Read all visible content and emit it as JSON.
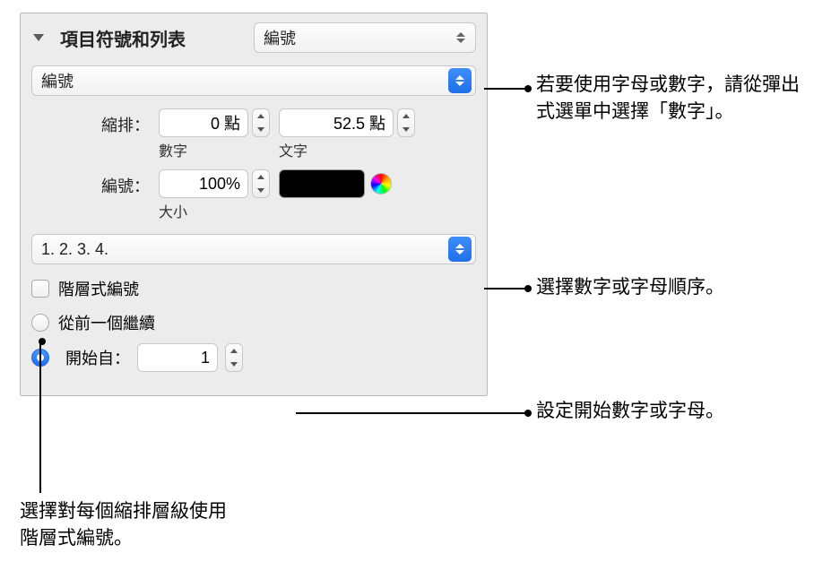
{
  "header": {
    "title": "項目符號和列表",
    "style_select": "編號"
  },
  "format_select": "編號",
  "indent": {
    "label": "縮排：",
    "number_value": "0 點",
    "number_caption": "數字",
    "text_value": "52.5 點",
    "text_caption": "文字"
  },
  "numbering": {
    "label": "編號：",
    "size_value": "100%",
    "size_caption": "大小"
  },
  "sequence_select": "1. 2. 3. 4.",
  "hierarchical_checkbox_label": "階層式編號",
  "continue_radio_label": "從前一個繼續",
  "start_from": {
    "label": "開始自：",
    "value": "1"
  },
  "callouts": {
    "format": "若要使用字母或數字，請從彈出式選單中選擇「數字」。",
    "sequence": "選擇數字或字母順序。",
    "start": "設定開始數字或字母。",
    "hierarchical": "選擇對每個縮排層級使用階層式編號。"
  }
}
